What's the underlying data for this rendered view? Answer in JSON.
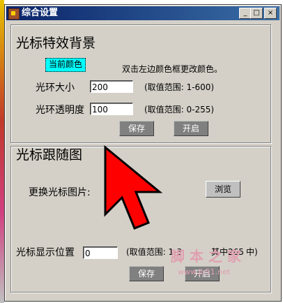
{
  "window": {
    "title": "综合设置",
    "minimize": "_",
    "maximize": "□",
    "close": "×"
  },
  "effect": {
    "heading": "光标特效背景",
    "current_color_label": "当前颜色",
    "color_hint": "双击左边颜色框更改颜色。",
    "size_label": "光环大小",
    "size_value": "200",
    "size_range": "(取值范围: 1-600)",
    "opacity_label": "光环透明度",
    "opacity_value": "100",
    "opacity_range": "(取值范围: 0-255)",
    "save_label": "保存",
    "enable_label": "开启"
  },
  "follow": {
    "heading": "光标跟随图",
    "change_image_label": "更换光标图片:",
    "browse_label": "浏览",
    "position_label": "光标显示位置",
    "position_value": "0",
    "position_range": "(取值范围: 1-3",
    "position_range_tail": "其中265",
    "position_range_end": "中)",
    "save_label": "保存",
    "enable_label": "开启"
  },
  "watermark": {
    "text": "脚 本 之 家",
    "url": "www.jb51.net"
  },
  "colors": {
    "pointer_fill": "#ff0000",
    "current_color": "#00ffff"
  }
}
